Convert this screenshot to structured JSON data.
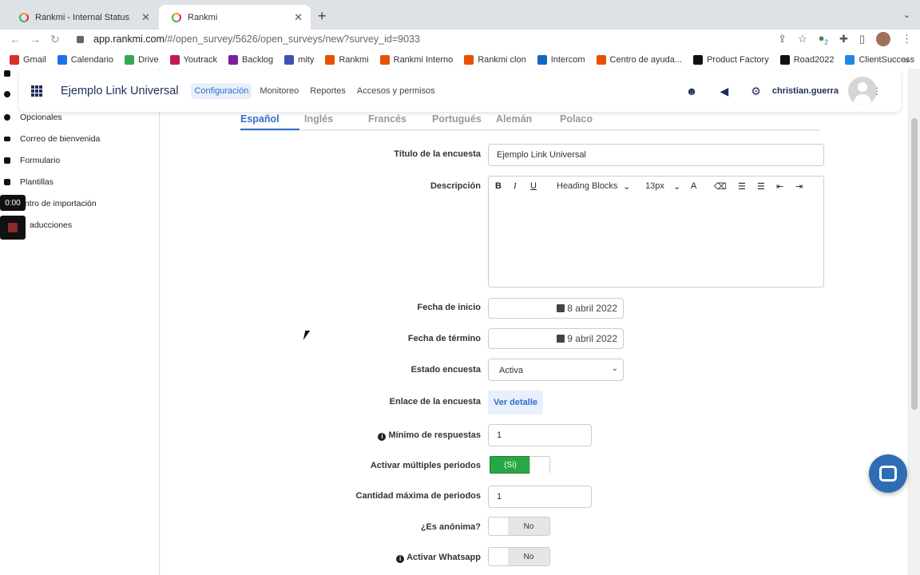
{
  "browser": {
    "tabs": [
      {
        "title": "Rankmi - Internal Status"
      },
      {
        "title": "Rankmi"
      }
    ],
    "url_host": "app.rankmi.com",
    "url_path": "/#/open_survey/5626/open_surveys/new?survey_id=9033",
    "extension_badge": "2",
    "bookmarks": [
      "Gmail",
      "Calendario",
      "Drive",
      "Youtrack",
      "Backlog",
      "mity",
      "Rankmi",
      "Rankmi Interno",
      "Rankmi clon",
      "Intercom",
      "Centro de ayuda...",
      "Product Factory",
      "Road2022",
      "ClientSuccess"
    ],
    "bookmark_colors": [
      "#d93025",
      "#1a73e8",
      "#34a853",
      "#c2185b",
      "#7b1fa2",
      "#3f51b5",
      "#e65100",
      "#e65100",
      "#e65100",
      "#1565c0",
      "#e65100",
      "#111111",
      "#111111",
      "#1e88e5"
    ]
  },
  "recording": {
    "time": "0:00"
  },
  "sidebar": {
    "items": [
      "Opcionales",
      "Correo de bienvenida",
      "Formulario",
      "Plantillas",
      "entro de importación",
      "aducciones"
    ]
  },
  "header": {
    "title": "Ejemplo Link Universal",
    "nav": [
      "Configuración",
      "Monitoreo",
      "Reportes",
      "Accesos y permisos"
    ],
    "user": "christian.guerra"
  },
  "languages": [
    "Español",
    "Inglés",
    "Francés",
    "Portugués",
    "Alemán",
    "Polaco"
  ],
  "form": {
    "titulo_label": "Título de la encuesta",
    "titulo_value": "Ejemplo Link Universal",
    "descripcion_label": "Descripción",
    "editor": {
      "heading": "Heading Blocks",
      "size": "13px"
    },
    "fecha_inicio_label": "Fecha de inicio",
    "fecha_inicio_value": "8 abril 2022",
    "fecha_termino_label": "Fecha de término",
    "fecha_termino_value": "9 abril 2022",
    "estado_label": "Estado encuesta",
    "estado_value": "Activa",
    "enlace_label": "Enlace de la encuesta",
    "enlace_button": "Ver detalle",
    "minimo_label": "Mínimo de respuestas",
    "minimo_value": "1",
    "multiples_label": "Activar múltiples periodos",
    "multiples_value": "(Si)",
    "cantidad_label": "Cantidad máxima de periodos",
    "cantidad_value": "1",
    "anonima_label": "¿Es anónima?",
    "anonima_value": "No",
    "whatsapp_label": "Activar Whatsapp",
    "whatsapp_value": "No"
  },
  "colors": {
    "accent": "#2f6fce",
    "toggle_on": "#28a745",
    "chat": "#2e6db4"
  }
}
